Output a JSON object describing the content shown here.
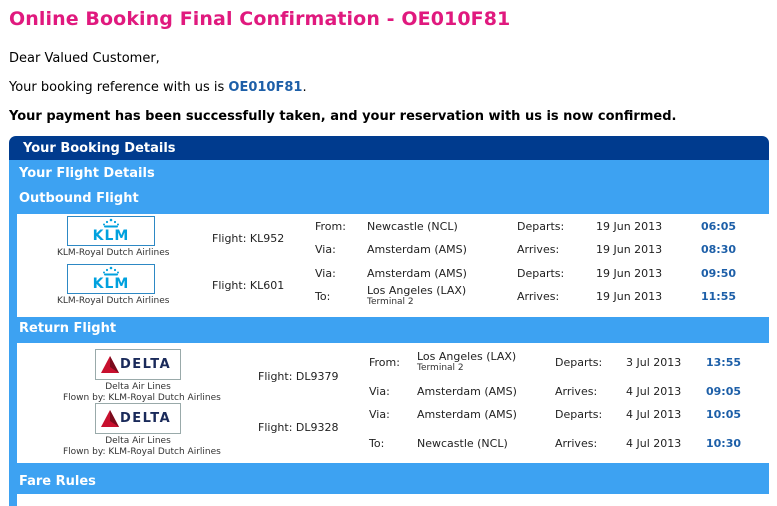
{
  "page_title": "Online Booking Final Confirmation - OE010F81",
  "greeting": "Dear Valued Customer,",
  "ref_prefix": "Your booking reference with us is ",
  "ref_code": "OE010F81",
  "ref_suffix": ".",
  "payment_msg": "Your payment has been successfully taken, and your reservation with us is now confirmed.",
  "booking": {
    "header": "Your Booking Details",
    "flight_details": "Your Flight Details",
    "outbound_label": "Outbound Flight",
    "return_label": "Return Flight",
    "fare_rules": "Fare Rules"
  },
  "labels": {
    "from": "From:",
    "via": "Via:",
    "to": "To:",
    "departs": "Departs:",
    "arrives": "Arrives:"
  },
  "outbound": [
    {
      "airline": "KLM-Royal Dutch Airlines",
      "logo_text": "KLM",
      "flight": "Flight: KL952",
      "from_place": "Newcastle (NCL)",
      "from_date": "19 Jun 2013",
      "from_time": "06:05",
      "to_place": "Amsterdam (AMS)",
      "to_date": "19 Jun 2013",
      "to_time": "08:30"
    },
    {
      "airline": "KLM-Royal Dutch Airlines",
      "logo_text": "KLM",
      "flight": "Flight: KL601",
      "from_place": "Amsterdam (AMS)",
      "from_date": "19 Jun 2013",
      "from_time": "09:50",
      "to_place": "Los Angeles (LAX)",
      "to_sub": "Terminal 2",
      "to_date": "19 Jun 2013",
      "to_time": "11:55"
    }
  ],
  "return": [
    {
      "airline": "Delta Air Lines",
      "flown_by": "Flown by: KLM-Royal Dutch Airlines",
      "logo_text": "DELTA",
      "flight": "Flight: DL9379",
      "from_place": "Los Angeles (LAX)",
      "from_sub": "Terminal 2",
      "from_date": "3 Jul 2013",
      "from_time": "13:55",
      "to_place": "Amsterdam (AMS)",
      "to_date": "4 Jul 2013",
      "to_time": "09:05"
    },
    {
      "airline": "Delta Air Lines",
      "flown_by": "Flown by: KLM-Royal Dutch Airlines",
      "logo_text": "DELTA",
      "flight": "Flight: DL9328",
      "from_place": "Amsterdam (AMS)",
      "from_date": "4 Jul 2013",
      "from_time": "10:05",
      "to_place": "Newcastle (NCL)",
      "to_date": "4 Jul 2013",
      "to_time": "10:30"
    }
  ],
  "colors": {
    "title": "#e0197e",
    "header_bg": "#003b8e",
    "band_bg": "#3da2f2",
    "time": "#1d5fa8",
    "delta_red": "#c8102e",
    "klm_blue": "#00a1de"
  }
}
